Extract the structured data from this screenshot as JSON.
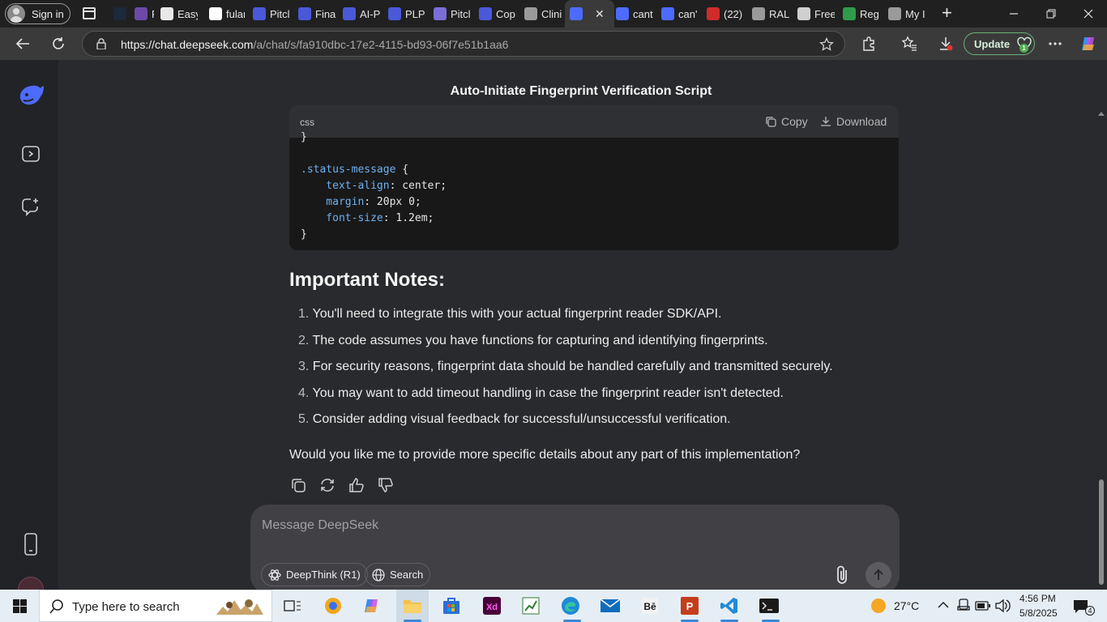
{
  "browser": {
    "signin_label": "Sign in",
    "tabs": [
      {
        "label": "",
        "color": "#1a2a3a"
      },
      {
        "label": "PLP",
        "color": "#6b4aa8"
      },
      {
        "label": "Easy",
        "color": "#e8e8e8"
      },
      {
        "label": "fular",
        "color": "#ffffff"
      },
      {
        "label": "Pitcl",
        "color": "#4a59d8"
      },
      {
        "label": "Fina",
        "color": "#4a59d8"
      },
      {
        "label": "AI-P",
        "color": "#4a59d8"
      },
      {
        "label": "PLP",
        "color": "#4a59d8"
      },
      {
        "label": "Pitcl",
        "color": "#7b6ed8"
      },
      {
        "label": "Cop",
        "color": "#4a59d8"
      },
      {
        "label": "Clini",
        "color": "#9a9a9a"
      },
      {
        "label": "",
        "color": "#4d6bfe",
        "active": true
      },
      {
        "label": "cant",
        "color": "#4d6bfe"
      },
      {
        "label": "can'",
        "color": "#4d6bfe"
      },
      {
        "label": "(22)",
        "color": "#d12b2b"
      },
      {
        "label": "RAL",
        "color": "#9a9a9a"
      },
      {
        "label": "Free",
        "color": "#cfcfcf"
      },
      {
        "label": "Reg",
        "color": "#2e9c4a"
      },
      {
        "label": "My I",
        "color": "#9a9a9a"
      }
    ],
    "url_host": "https://chat.deepseek.com",
    "url_path": "/a/chat/s/fa910dbc-17e2-4115-bd93-06f7e51b1aa6",
    "update_label": "Update",
    "update_badge": "1"
  },
  "chat": {
    "title": "Auto-Initiate Fingerprint Verification Script",
    "code": {
      "language": "css",
      "copy_label": "Copy",
      "download_label": "Download",
      "lines": [
        {
          "t": "}"
        },
        {
          "t": ""
        },
        {
          "sel": ".status-message",
          "t": " {"
        },
        {
          "prop": "    text-align",
          "t": ": center;"
        },
        {
          "prop": "    margin",
          "t": ": 20px 0;"
        },
        {
          "prop": "    font-size",
          "t": ": 1.2em;"
        },
        {
          "t": "}"
        }
      ]
    },
    "notes_heading": "Important Notes:",
    "notes": [
      {
        "n": "1.",
        "text": "You'll need to integrate this with your actual fingerprint reader SDK/API."
      },
      {
        "n": "2.",
        "text": "The code assumes you have functions for capturing and identifying fingerprints."
      },
      {
        "n": "3.",
        "text": "For security reasons, fingerprint data should be handled carefully and transmitted securely."
      },
      {
        "n": "4.",
        "text": "You may want to add timeout handling in case the fingerprint reader isn't detected."
      },
      {
        "n": "5.",
        "text": "Consider adding visual feedback for successful/unsuccessful verification."
      }
    ],
    "followup": "Would you like me to provide more specific details about any part of this implementation?",
    "composer_placeholder": "Message DeepSeek",
    "deepthink_label": "DeepThink (R1)",
    "search_label": "Search"
  },
  "taskbar": {
    "search_placeholder": "Type here to search",
    "weather": "27°C",
    "time": "4:56 PM",
    "date": "5/8/2025",
    "notif_count": "4"
  },
  "colors": {
    "accent": "#4d6bfe",
    "page_bg": "#292a2d",
    "sidebar_bg": "#212327"
  }
}
